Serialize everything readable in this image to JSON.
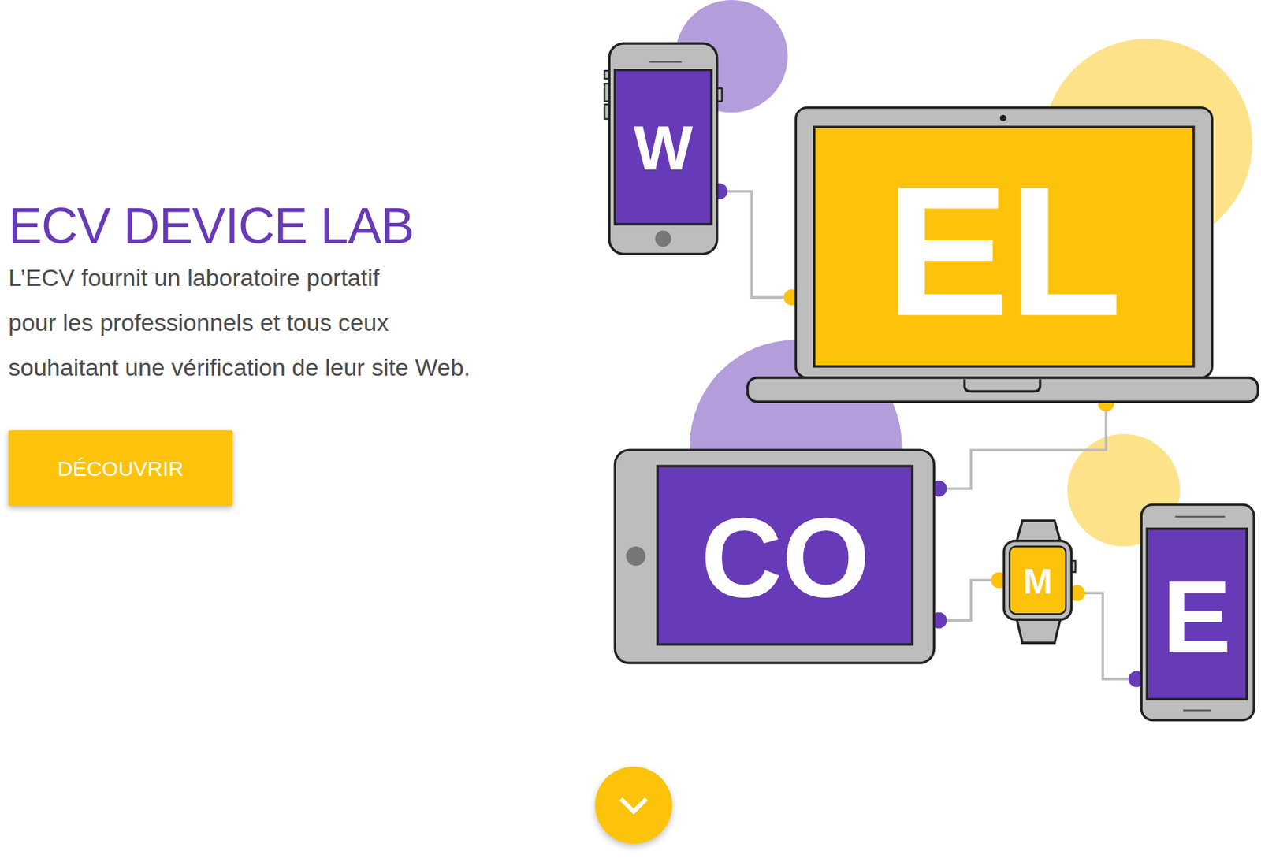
{
  "hero": {
    "title": "ECV DEVICE LAB",
    "description_lines": [
      "L’ECV fournit un laboratoire portatif",
      "pour les professionnels et tous ceux",
      "souhaitant une vérification de leur site Web."
    ],
    "button": "DÉCOUVRIR"
  },
  "illustration": {
    "phone": "W",
    "laptop": "EL",
    "tablet": "CO",
    "watch": "M",
    "phone_2": "E"
  }
}
